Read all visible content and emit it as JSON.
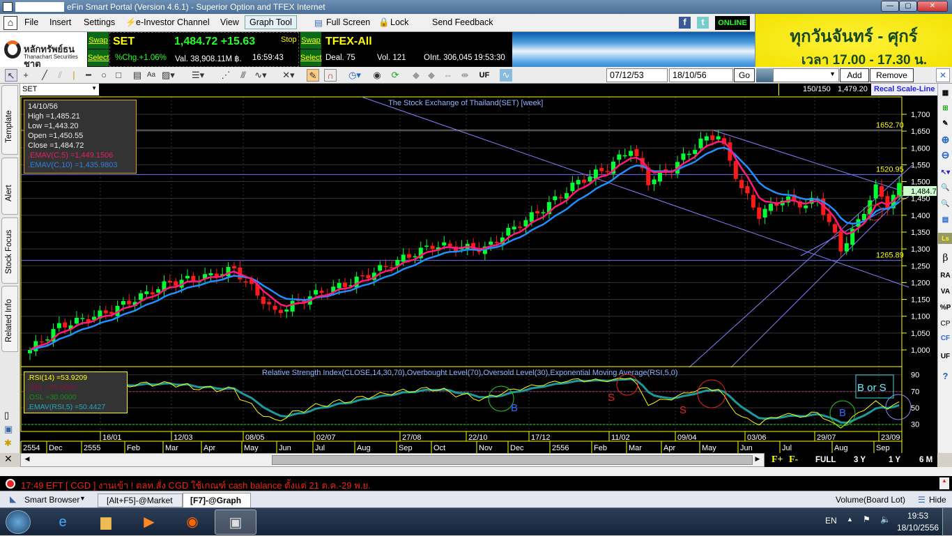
{
  "window": {
    "title": "eFin Smart Portal (Version 4.6.1) - Superior Option and TFEX Internet",
    "minimize": "—",
    "maximize": "▢",
    "close": "✕"
  },
  "menu": {
    "items": [
      "File",
      "Insert",
      "Settings",
      "e-Investor Channel",
      "View",
      "Graph Tool",
      "Full Screen",
      "Lock",
      "Send Feedback"
    ],
    "status": "ONLINE"
  },
  "broker": {
    "name_th": "หลักทรัพย์ธนชาต",
    "name_en": "Thanachart Securities"
  },
  "set_ticker": {
    "swap": "Swap",
    "select": "Select",
    "symbol": "SET",
    "price": "1,484.72 +15.63",
    "stop": "Stop",
    "pct_change": "%Chg.+1.06%",
    "value": "Val. 38,908.11M ฿.",
    "time": "16:59:43"
  },
  "tfex_ticker": {
    "swap": "Swap",
    "select": "Select",
    "symbol": "TFEX-All",
    "deal": "Deal. 75",
    "vol": "Vol. 121",
    "oint": "OInt. 306,045",
    "time": "19:53:30"
  },
  "ad": {
    "line1": "ทุกวันจันทร์ - ศุกร์",
    "line2": "เวลา 17.00 - 17.30 น."
  },
  "toolbar": {
    "uf": "UF",
    "date_from": "07/12/53",
    "date_to": "18/10/56",
    "go": "Go",
    "template_select": "",
    "add": "Add",
    "remove": "Remove"
  },
  "chart_header": {
    "symbol": "SET",
    "bars": "150/150",
    "last": "1,479.20",
    "recal": "Recal Scale-Line"
  },
  "left_tabs": [
    "Template",
    "Alert",
    "Stock Focus",
    "Related Info"
  ],
  "right_tools": [
    "RA",
    "VA",
    "%P",
    "CP",
    "CF",
    "UF"
  ],
  "info_box": {
    "date": "14/10/56",
    "high": "High  =1,485.21",
    "low": "Low   =1,443.20",
    "open": "Open  =1,450.55",
    "close": "Close  =1,484.72",
    "ema5": ".EMAV(C,5)    =1,449.1506",
    "ema10": ".EMAV(C,10)   =1,435.9803"
  },
  "rsi_box": {
    "rsi": ".RSI(14)    =53.9209",
    "obl": ".OBL    =70.0000",
    "osl": ".OSL    =30.0000",
    "ema": ".EMAV(RSI,5)    =50.4427"
  },
  "annotations": {
    "b1": "B",
    "s1": "S",
    "s2": "S",
    "b2": "B",
    "bors": "B or S"
  },
  "zoom_bar": {
    "fplus": "F+",
    "fminus": "F-",
    "full": "FULL",
    "y3": "3 Y",
    "y1": "1 Y",
    "m6": "6 M"
  },
  "news": "17:49  EFT  [ CGD ]  งานเข้า ! ตลท.สั่ง CGD ใช้เกณฑ์ cash balance ตั้งแต่ 21 ต.ค.-29 พ.ย.",
  "tabs": {
    "browser": "Smart Browser",
    "tab1": "[Alt+F5]-@Market",
    "tab2": "[F7]-@Graph",
    "volume": "Volume(Board Lot)",
    "hide": "Hide"
  },
  "tray": {
    "lang": "EN",
    "time": "19:53",
    "date": "18/10/2556"
  },
  "chart_data": {
    "type": "candlestick",
    "title": "The Stock Exchange of Thailand(SET) [week]",
    "rsi_title": "Relative Strength Index(CLOSE,14,30,70),Overbought Level(70),Oversold Level(30),Exponential Moving Average(RSI,5,0)",
    "ylim": [
      950,
      1750
    ],
    "y_ticks": [
      "1,000",
      "1,050",
      "1,100",
      "1,150",
      "1,200",
      "1,250",
      "1,300",
      "1,350",
      "1,400",
      "1,450",
      "1,500",
      "1,550",
      "1,600",
      "1,650",
      "1,700"
    ],
    "y_tick_values": [
      1000,
      1050,
      1100,
      1150,
      1200,
      1250,
      1300,
      1350,
      1400,
      1450,
      1500,
      1550,
      1600,
      1650,
      1700
    ],
    "rsi_ticks": [
      30,
      50,
      70,
      90
    ],
    "last_price_label": "1,484.7",
    "levels": [
      {
        "value": 1652.7,
        "label": "1652.70"
      },
      {
        "value": 1520.95,
        "label": "1520.95"
      },
      {
        "value": 1265.89,
        "label": "1265.89"
      }
    ],
    "date_labels": [
      "16/01",
      "12/03",
      "08/05",
      "02/07",
      "27/08",
      "22/10",
      "17/12",
      "11/02",
      "09/04",
      "03/06",
      "29/07",
      "23/09"
    ],
    "month_labels": [
      "2554",
      "Dec",
      "2555",
      "Feb",
      "Mar",
      "Apr",
      "May",
      "Jun",
      "Jul",
      "Aug",
      "Sep",
      "Oct",
      "Nov",
      "Dec",
      "2556",
      "Feb",
      "Mar",
      "Apr",
      "May",
      "Jun",
      "Jul",
      "Aug",
      "Sep"
    ],
    "close_keypoints": [
      [
        0,
        1000
      ],
      [
        5,
        1070
      ],
      [
        13,
        1110
      ],
      [
        24,
        1200
      ],
      [
        31,
        1220
      ],
      [
        35,
        1240
      ],
      [
        42,
        1110
      ],
      [
        48,
        1160
      ],
      [
        55,
        1200
      ],
      [
        65,
        1280
      ],
      [
        69,
        1310
      ],
      [
        78,
        1300
      ],
      [
        81,
        1340
      ],
      [
        88,
        1420
      ],
      [
        94,
        1500
      ],
      [
        99,
        1540
      ],
      [
        103,
        1600
      ],
      [
        106,
        1500
      ],
      [
        110,
        1540
      ],
      [
        115,
        1620
      ],
      [
        118,
        1640
      ],
      [
        122,
        1480
      ],
      [
        125,
        1400
      ],
      [
        129,
        1450
      ],
      [
        133,
        1430
      ],
      [
        135,
        1450
      ],
      [
        139,
        1300
      ],
      [
        141,
        1350
      ],
      [
        145,
        1480
      ],
      [
        147,
        1430
      ],
      [
        149,
        1485
      ]
    ],
    "bars": 150,
    "colors": {
      "up": "#00ff33",
      "down": "#ff1a1a",
      "ema5": "#ff1a7a",
      "ema10": "#1e90ff",
      "rsi": "#ffff00",
      "rsi_ema": "#1a9a9a"
    }
  }
}
